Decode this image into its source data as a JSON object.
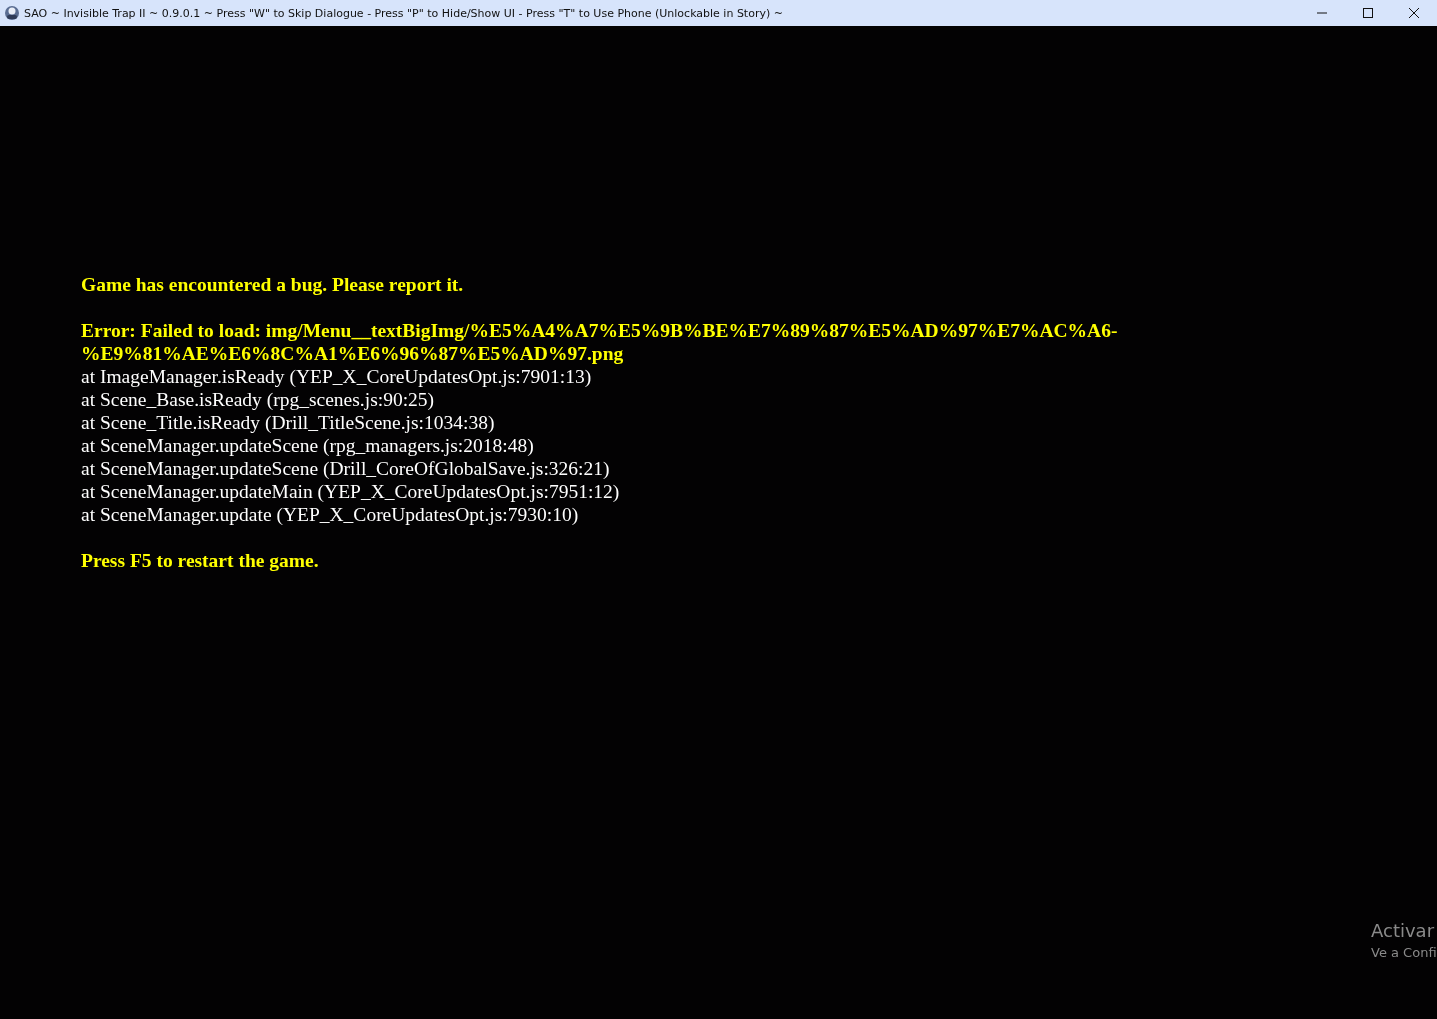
{
  "window": {
    "title": "SAO ~ Invisible Trap II ~ 0.9.0.1 ~ Press \"W\" to Skip Dialogue - Press \"P\" to Hide/Show UI - Press \"T\" to Use Phone (Unlockable in Story) ~"
  },
  "error_screen": {
    "heading": "Game has encountered a bug. Please report it.",
    "error_lines": [
      "Error: Failed to load: img/Menu__textBigImg/%E5%A4%A7%E5%9B%BE%E7%89%87%E5%AD%97%E7%AC%A6-",
      "%E9%81%AE%E6%8C%A1%E6%96%87%E5%AD%97.png"
    ],
    "stack": [
      "at ImageManager.isReady (YEP_X_CoreUpdatesOpt.js:7901:13)",
      "at Scene_Base.isReady (rpg_scenes.js:90:25)",
      "at Scene_Title.isReady (Drill_TitleScene.js:1034:38)",
      "at SceneManager.updateScene (rpg_managers.js:2018:48)",
      "at SceneManager.updateScene (Drill_CoreOfGlobalSave.js:326:21)",
      "at SceneManager.updateMain (YEP_X_CoreUpdatesOpt.js:7951:12)",
      "at SceneManager.update (YEP_X_CoreUpdatesOpt.js:7930:10)"
    ],
    "footer": "Press F5 to restart the game."
  },
  "activation_notice": {
    "title": "Activar",
    "subtitle": "Ve a Confi"
  }
}
